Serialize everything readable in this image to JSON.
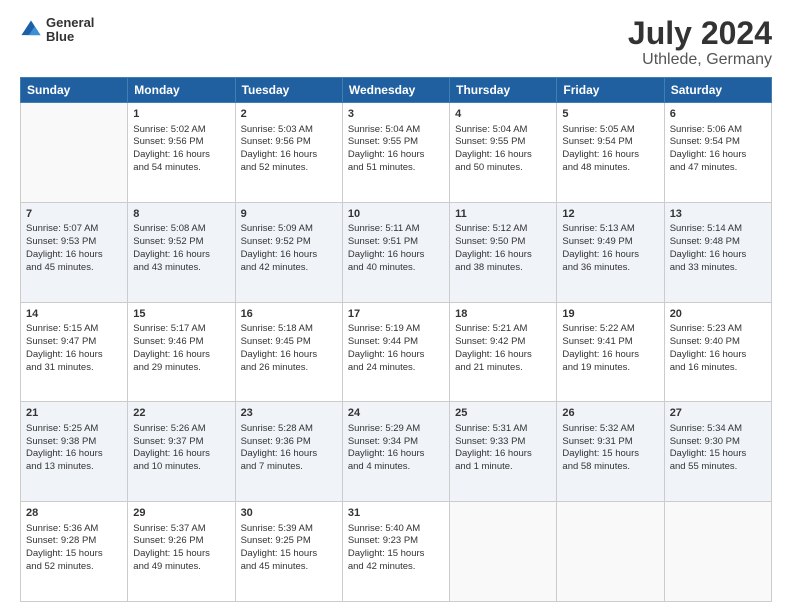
{
  "header": {
    "logo": {
      "line1": "General",
      "line2": "Blue"
    },
    "title": "July 2024",
    "subtitle": "Uthlede, Germany"
  },
  "weekdays": [
    "Sunday",
    "Monday",
    "Tuesday",
    "Wednesday",
    "Thursday",
    "Friday",
    "Saturday"
  ],
  "weeks": [
    [
      {
        "day": "",
        "info": ""
      },
      {
        "day": "1",
        "info": "Sunrise: 5:02 AM\nSunset: 9:56 PM\nDaylight: 16 hours\nand 54 minutes."
      },
      {
        "day": "2",
        "info": "Sunrise: 5:03 AM\nSunset: 9:56 PM\nDaylight: 16 hours\nand 52 minutes."
      },
      {
        "day": "3",
        "info": "Sunrise: 5:04 AM\nSunset: 9:55 PM\nDaylight: 16 hours\nand 51 minutes."
      },
      {
        "day": "4",
        "info": "Sunrise: 5:04 AM\nSunset: 9:55 PM\nDaylight: 16 hours\nand 50 minutes."
      },
      {
        "day": "5",
        "info": "Sunrise: 5:05 AM\nSunset: 9:54 PM\nDaylight: 16 hours\nand 48 minutes."
      },
      {
        "day": "6",
        "info": "Sunrise: 5:06 AM\nSunset: 9:54 PM\nDaylight: 16 hours\nand 47 minutes."
      }
    ],
    [
      {
        "day": "7",
        "info": "Sunrise: 5:07 AM\nSunset: 9:53 PM\nDaylight: 16 hours\nand 45 minutes."
      },
      {
        "day": "8",
        "info": "Sunrise: 5:08 AM\nSunset: 9:52 PM\nDaylight: 16 hours\nand 43 minutes."
      },
      {
        "day": "9",
        "info": "Sunrise: 5:09 AM\nSunset: 9:52 PM\nDaylight: 16 hours\nand 42 minutes."
      },
      {
        "day": "10",
        "info": "Sunrise: 5:11 AM\nSunset: 9:51 PM\nDaylight: 16 hours\nand 40 minutes."
      },
      {
        "day": "11",
        "info": "Sunrise: 5:12 AM\nSunset: 9:50 PM\nDaylight: 16 hours\nand 38 minutes."
      },
      {
        "day": "12",
        "info": "Sunrise: 5:13 AM\nSunset: 9:49 PM\nDaylight: 16 hours\nand 36 minutes."
      },
      {
        "day": "13",
        "info": "Sunrise: 5:14 AM\nSunset: 9:48 PM\nDaylight: 16 hours\nand 33 minutes."
      }
    ],
    [
      {
        "day": "14",
        "info": "Sunrise: 5:15 AM\nSunset: 9:47 PM\nDaylight: 16 hours\nand 31 minutes."
      },
      {
        "day": "15",
        "info": "Sunrise: 5:17 AM\nSunset: 9:46 PM\nDaylight: 16 hours\nand 29 minutes."
      },
      {
        "day": "16",
        "info": "Sunrise: 5:18 AM\nSunset: 9:45 PM\nDaylight: 16 hours\nand 26 minutes."
      },
      {
        "day": "17",
        "info": "Sunrise: 5:19 AM\nSunset: 9:44 PM\nDaylight: 16 hours\nand 24 minutes."
      },
      {
        "day": "18",
        "info": "Sunrise: 5:21 AM\nSunset: 9:42 PM\nDaylight: 16 hours\nand 21 minutes."
      },
      {
        "day": "19",
        "info": "Sunrise: 5:22 AM\nSunset: 9:41 PM\nDaylight: 16 hours\nand 19 minutes."
      },
      {
        "day": "20",
        "info": "Sunrise: 5:23 AM\nSunset: 9:40 PM\nDaylight: 16 hours\nand 16 minutes."
      }
    ],
    [
      {
        "day": "21",
        "info": "Sunrise: 5:25 AM\nSunset: 9:38 PM\nDaylight: 16 hours\nand 13 minutes."
      },
      {
        "day": "22",
        "info": "Sunrise: 5:26 AM\nSunset: 9:37 PM\nDaylight: 16 hours\nand 10 minutes."
      },
      {
        "day": "23",
        "info": "Sunrise: 5:28 AM\nSunset: 9:36 PM\nDaylight: 16 hours\nand 7 minutes."
      },
      {
        "day": "24",
        "info": "Sunrise: 5:29 AM\nSunset: 9:34 PM\nDaylight: 16 hours\nand 4 minutes."
      },
      {
        "day": "25",
        "info": "Sunrise: 5:31 AM\nSunset: 9:33 PM\nDaylight: 16 hours\nand 1 minute."
      },
      {
        "day": "26",
        "info": "Sunrise: 5:32 AM\nSunset: 9:31 PM\nDaylight: 15 hours\nand 58 minutes."
      },
      {
        "day": "27",
        "info": "Sunrise: 5:34 AM\nSunset: 9:30 PM\nDaylight: 15 hours\nand 55 minutes."
      }
    ],
    [
      {
        "day": "28",
        "info": "Sunrise: 5:36 AM\nSunset: 9:28 PM\nDaylight: 15 hours\nand 52 minutes."
      },
      {
        "day": "29",
        "info": "Sunrise: 5:37 AM\nSunset: 9:26 PM\nDaylight: 15 hours\nand 49 minutes."
      },
      {
        "day": "30",
        "info": "Sunrise: 5:39 AM\nSunset: 9:25 PM\nDaylight: 15 hours\nand 45 minutes."
      },
      {
        "day": "31",
        "info": "Sunrise: 5:40 AM\nSunset: 9:23 PM\nDaylight: 15 hours\nand 42 minutes."
      },
      {
        "day": "",
        "info": ""
      },
      {
        "day": "",
        "info": ""
      },
      {
        "day": "",
        "info": ""
      }
    ]
  ]
}
